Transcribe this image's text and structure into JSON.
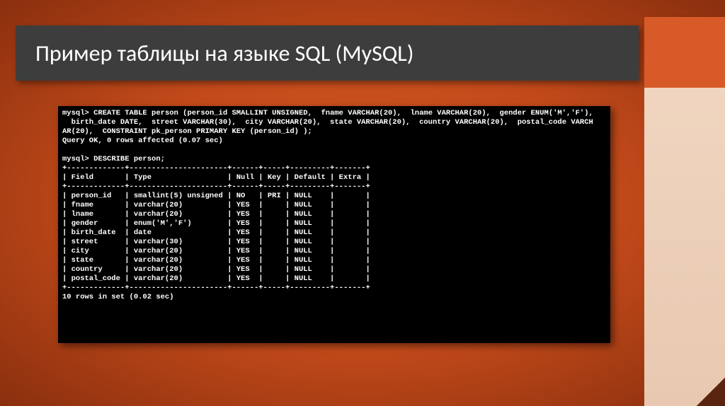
{
  "header": {
    "title": "Пример таблицы на языке SQL (MySQL)"
  },
  "terminal": {
    "prompt1": "mysql>",
    "create_cmd": "CREATE TABLE person (person_id SMALLINT UNSIGNED,  fname VARCHAR(20),  lname VARCHAR(20),  gender ENUM('M','F'),",
    "create_cmd2": "  birth_date DATE,  street VARCHAR(30),  city VARCHAR(20),  state VARCHAR(20),  country VARCHAR(20),  postal_code VARCH",
    "create_cmd3": "AR(20),  CONSTRAINT pk_person PRIMARY KEY (person_id) );",
    "create_result": "Query OK, 0 rows affected (0.07 sec)",
    "describe_cmd": "DESCRIBE person;",
    "border": "+-------------+----------------------+------+-----+---------+-------+",
    "header_row": "| Field       | Type                 | Null | Key | Default | Extra |",
    "rows": [
      "| person_id   | smallint(5) unsigned | NO   | PRI | NULL    |       |",
      "| fname       | varchar(20)          | YES  |     | NULL    |       |",
      "| lname       | varchar(20)          | YES  |     | NULL    |       |",
      "| gender      | enum('M','F')        | YES  |     | NULL    |       |",
      "| birth_date  | date                 | YES  |     | NULL    |       |",
      "| street      | varchar(30)          | YES  |     | NULL    |       |",
      "| city        | varchar(20)          | YES  |     | NULL    |       |",
      "| state       | varchar(20)          | YES  |     | NULL    |       |",
      "| country     | varchar(20)          | YES  |     | NULL    |       |",
      "| postal_code | varchar(20)          | YES  |     | NULL    |       |"
    ],
    "footer": "10 rows in set (0.02 sec)"
  }
}
